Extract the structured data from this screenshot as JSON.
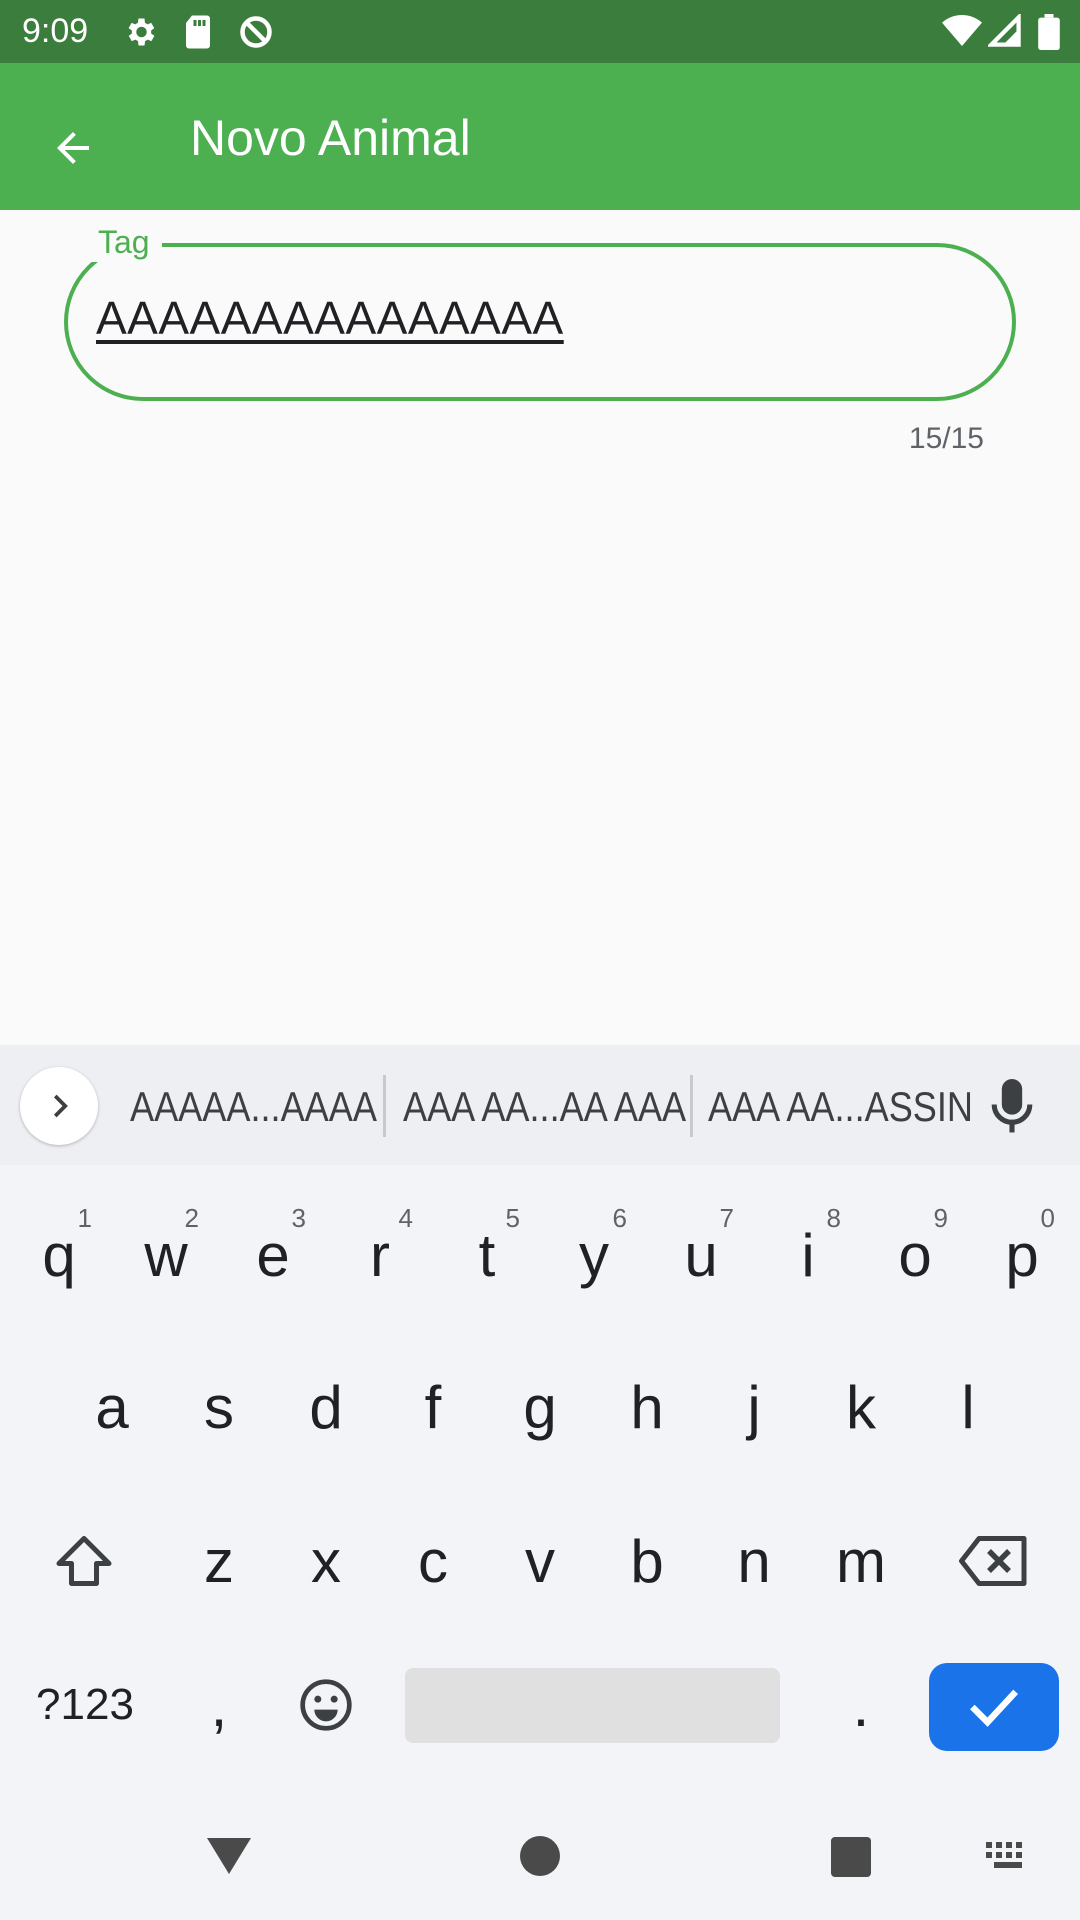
{
  "status_bar": {
    "time": "9:09",
    "icons": [
      "settings-icon",
      "sd-card-icon",
      "do-not-disturb-icon",
      "wifi-icon",
      "signal-icon",
      "battery-icon"
    ]
  },
  "app_bar": {
    "title": "Novo Animal",
    "back_icon": "arrow-back-icon",
    "color": "#4caf50"
  },
  "form": {
    "tag_label": "Tag",
    "tag_value": "AAAAAAAAAAAAAAA",
    "counter": "15/15",
    "accent": "#4caf50"
  },
  "keyboard": {
    "suggestions": [
      "AAAAA...AAAA",
      "AAA AA...AA AAA",
      "AAA AA...ASSIN"
    ],
    "row1": [
      {
        "key": "q",
        "num": "1"
      },
      {
        "key": "w",
        "num": "2"
      },
      {
        "key": "e",
        "num": "3"
      },
      {
        "key": "r",
        "num": "4"
      },
      {
        "key": "t",
        "num": "5"
      },
      {
        "key": "y",
        "num": "6"
      },
      {
        "key": "u",
        "num": "7"
      },
      {
        "key": "i",
        "num": "8"
      },
      {
        "key": "o",
        "num": "9"
      },
      {
        "key": "p",
        "num": "0"
      }
    ],
    "row2": [
      "a",
      "s",
      "d",
      "f",
      "g",
      "h",
      "j",
      "k",
      "l"
    ],
    "row3": [
      "z",
      "x",
      "c",
      "v",
      "b",
      "n",
      "m"
    ],
    "symbols_key": "?123",
    "comma_key": ",",
    "period_key": ".",
    "enter_color": "#1a73e8"
  }
}
